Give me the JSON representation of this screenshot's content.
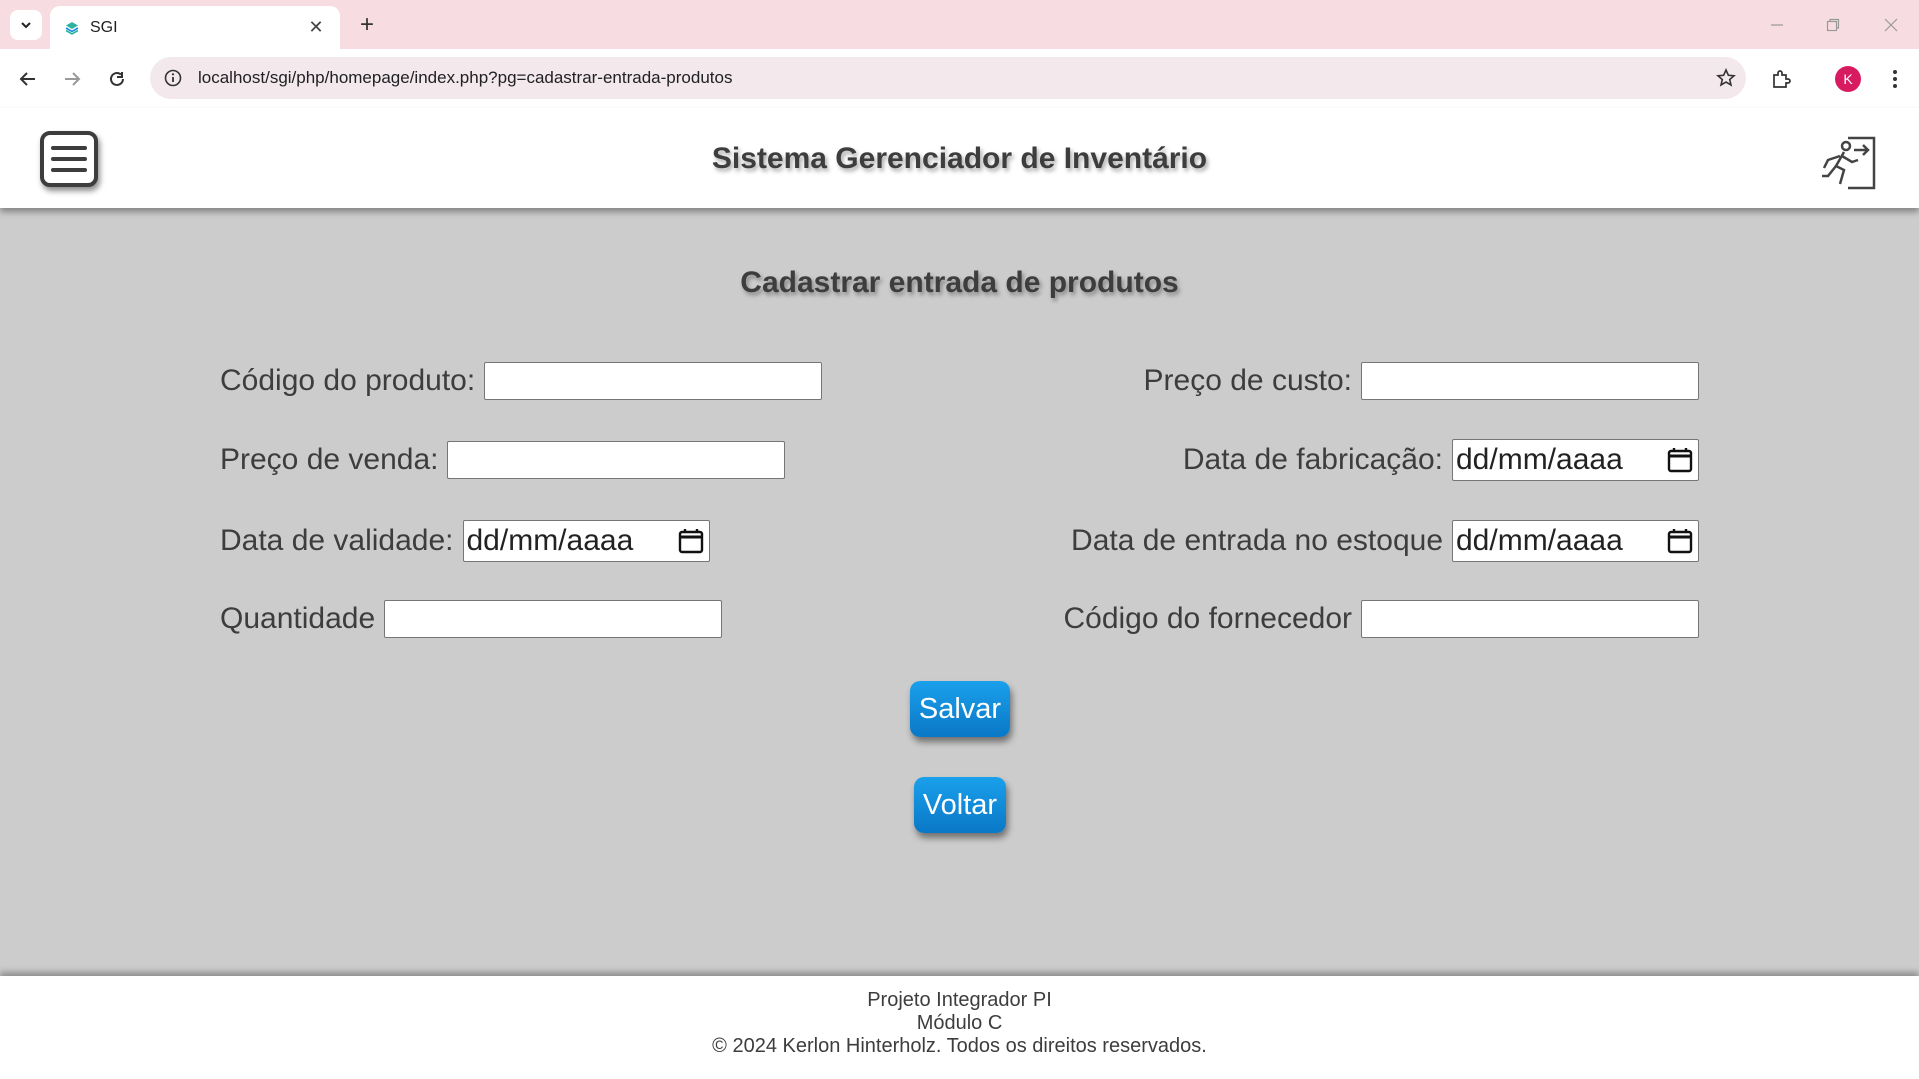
{
  "browser": {
    "tab_title": "SGI",
    "new_tab_label": "+",
    "url": "localhost/sgi/php/homepage/index.php?pg=cadastrar-entrada-produtos",
    "profile_initial": "K"
  },
  "header": {
    "title": "Sistema Gerenciador de Inventário"
  },
  "form": {
    "title": "Cadastrar entrada de produtos",
    "fields": {
      "codigo_produto": {
        "label": "Código do produto:",
        "value": ""
      },
      "preco_custo": {
        "label": "Preço de custo:",
        "value": ""
      },
      "preco_venda": {
        "label": "Preço de venda:",
        "value": ""
      },
      "data_fabricacao": {
        "label": "Data de fabricação:",
        "placeholder": "dd/mm/aaaa"
      },
      "data_validade": {
        "label": "Data de validade:",
        "placeholder": "dd/mm/aaaa"
      },
      "data_entrada": {
        "label": "Data de entrada no estoque",
        "placeholder": "dd/mm/aaaa"
      },
      "quantidade": {
        "label": "Quantidade",
        "value": ""
      },
      "codigo_fornecedor": {
        "label": "Código do fornecedor",
        "value": ""
      }
    },
    "save_label": "Salvar",
    "back_label": "Voltar"
  },
  "footer": {
    "line1": "Projeto Integrador PI",
    "line2": "Módulo C",
    "line3": "© 2024 Kerlon Hinterholz. Todos os direitos reservados."
  },
  "colors": {
    "page_bg": "#cccccc",
    "header_bg": "#ffffff",
    "button": "#0a8ad8",
    "text": "#3d3d3d"
  },
  "icons": [
    "tab-search-icon",
    "favicon-icon",
    "close-icon",
    "back-icon",
    "forward-icon",
    "reload-icon",
    "site-info-icon",
    "bookmark-star-icon",
    "extensions-icon",
    "kebab-menu-icon",
    "hamburger-menu-icon",
    "logout-exit-icon",
    "calendar-icon"
  ]
}
